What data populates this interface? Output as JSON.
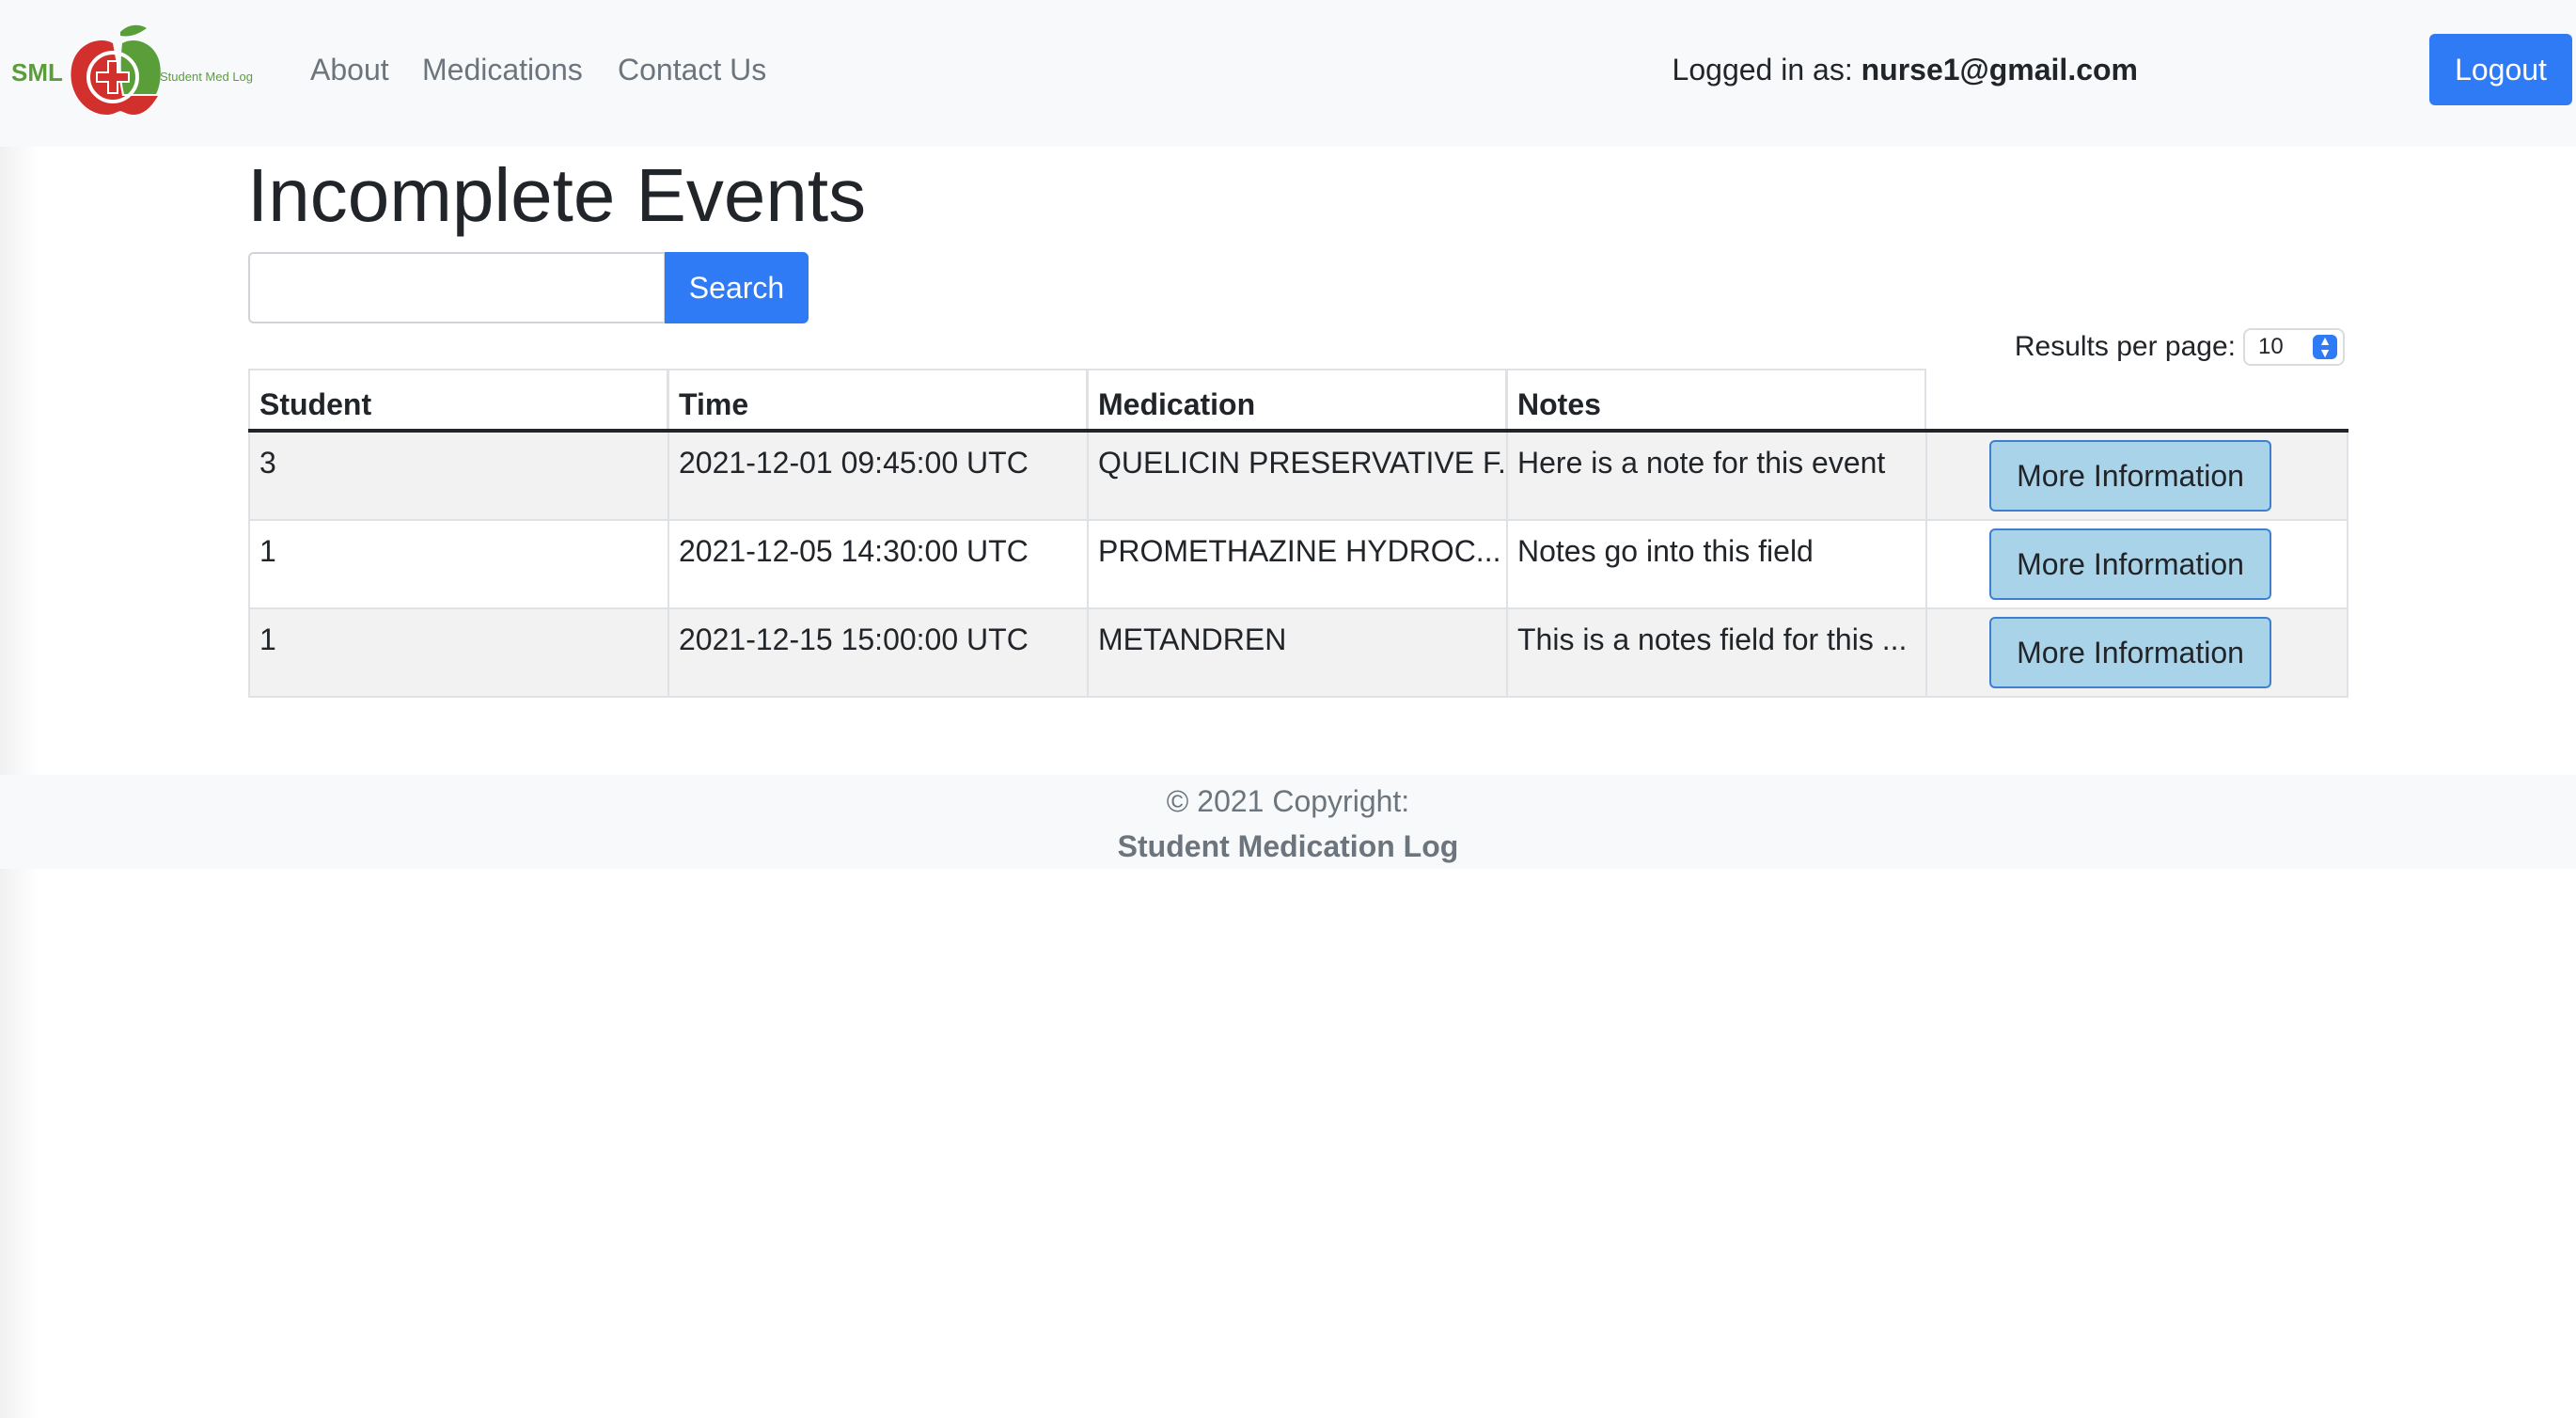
{
  "nav": {
    "logo_text": "SML",
    "logo_subtext": "Student Med Log",
    "links": [
      "About",
      "Medications",
      "Contact Us"
    ],
    "logged_in_label": "Logged in as:",
    "user_email": "nurse1@gmail.com",
    "logout_label": "Logout"
  },
  "page": {
    "title": "Incomplete Events",
    "search_placeholder": "",
    "search_label": "Search",
    "results_per_page_label": "Results per page:",
    "results_per_page_value": "10"
  },
  "table": {
    "headers": [
      "Student",
      "Time",
      "Medication",
      "Notes"
    ],
    "rows": [
      {
        "student": "3",
        "time": "2021-12-01 09:45:00 UTC",
        "medication": "QUELICIN PRESERVATIVE F...",
        "notes": "Here is a note for this event",
        "action": "More Information"
      },
      {
        "student": "1",
        "time": "2021-12-05 14:30:00 UTC",
        "medication": "PROMETHAZINE HYDROC...",
        "notes": "Notes go into this field",
        "action": "More Information"
      },
      {
        "student": "1",
        "time": "2021-12-15 15:00:00 UTC",
        "medication": "METANDREN",
        "notes": "This is a notes field for this ...",
        "action": "More Information"
      }
    ]
  },
  "footer": {
    "copyright": "© 2021 Copyright:",
    "brand": "Student Medication Log"
  },
  "colors": {
    "primary": "#2f7af5",
    "navbar_bg": "#f8f9fa",
    "more_info_bg": "#a9d3e8",
    "logo_red": "#d2302c",
    "logo_green": "#5a9e3a"
  }
}
